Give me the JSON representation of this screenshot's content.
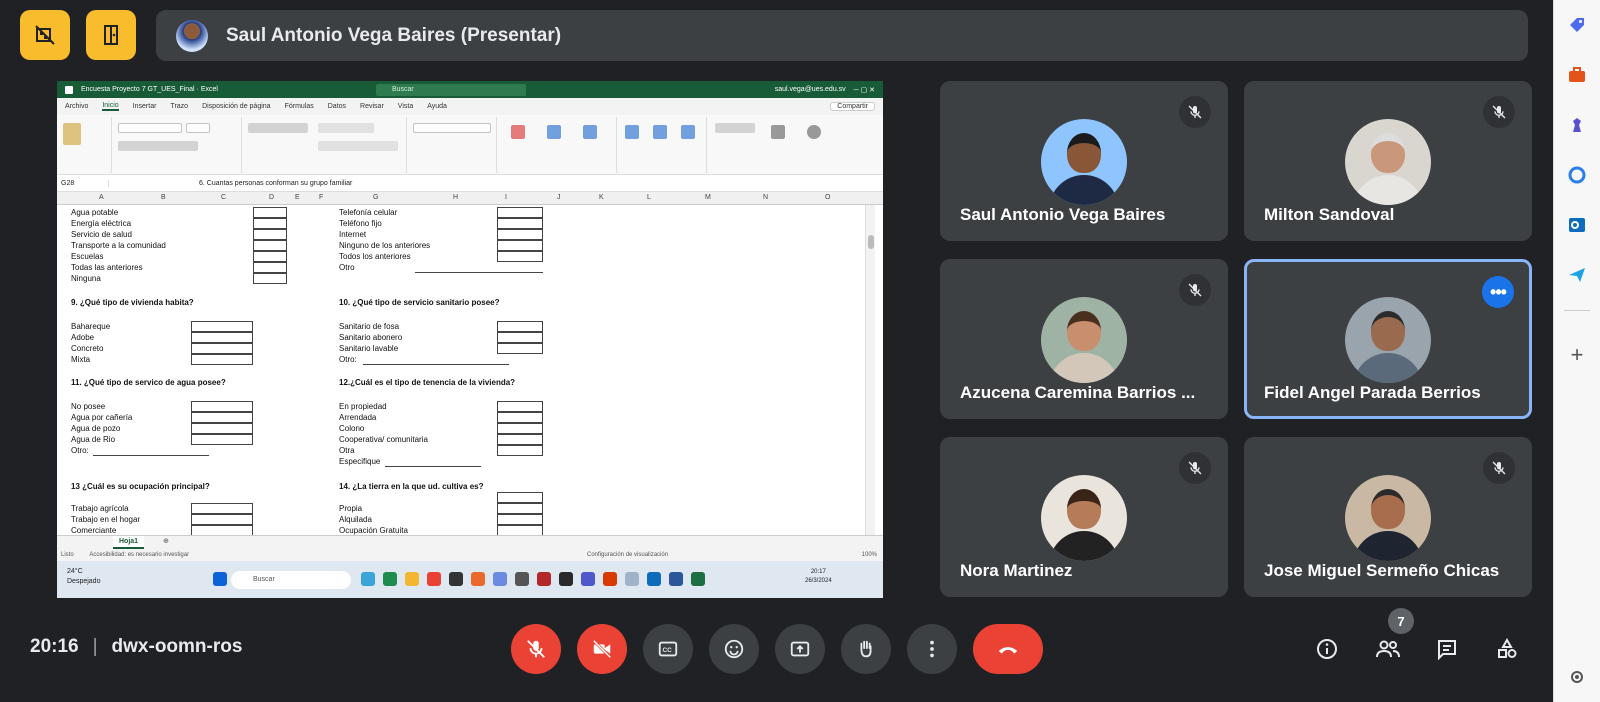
{
  "meeting": {
    "presenter_label": "Saul Antonio Vega Baires (Presentar)",
    "time": "20:16",
    "code": "dwx-oomn-ros",
    "participant_count": "7"
  },
  "participants": [
    {
      "name": "Saul Antonio Vega Baires",
      "muted": true
    },
    {
      "name": "Milton Sandoval",
      "muted": true
    },
    {
      "name": "Azucena Caremina Barrios ...",
      "muted": true
    },
    {
      "name": "Fidel Angel Parada Berrios",
      "muted": false,
      "active": true
    },
    {
      "name": "Nora Martinez",
      "muted": true
    },
    {
      "name": "Jose Miguel Sermeño Chicas",
      "muted": true
    }
  ],
  "shared_screen": {
    "title": "Encuesta Proyecto 7 GT_UES_Final · Excel",
    "search": "Buscar",
    "account": "saul.vega@ues.edu.sv",
    "menu": [
      "Archivo",
      "Inicio",
      "Insertar",
      "Trazo",
      "Disposición de página",
      "Fórmulas",
      "Datos",
      "Revisar",
      "Vista",
      "Ayuda"
    ],
    "share": "Compartir",
    "cell_ref": "G28",
    "formula": "6. Cuantas personas conforman su grupo familiar",
    "columns": [
      "A",
      "B",
      "C",
      "D",
      "E",
      "F",
      "G",
      "H",
      "I",
      "J",
      "K",
      "L",
      "M",
      "N",
      "O"
    ],
    "left_list_1": [
      "Agua potable",
      "Energía eléctrica",
      "Servicio de salud",
      "Transporte a la comunidad",
      "Escuelas",
      "Todas las anteriores",
      "Ninguna"
    ],
    "right_list_1": [
      "Telefonía celular",
      "Teléfono fijo",
      "Internet",
      "Ninguno de los anteriores",
      "Todos los anteriores",
      "Otro"
    ],
    "q9": "9. ¿Qué tipo de vivienda habita?",
    "q9_options": [
      "Bahareque",
      "Adobe",
      "Concreto",
      "Mixta"
    ],
    "q10": "10. ¿Qué tipo de servicio sanitario posee?",
    "q10_options": [
      "Sanitario de fosa",
      "Sanitario abonero",
      "Sanitario lavable",
      "Otro:"
    ],
    "q11": "11. ¿Qué tipo de servico de agua posee?",
    "q11_options": [
      "No posee",
      "Agua por cañería",
      "Agua de pozo",
      "Agua de Rio",
      "Otro:"
    ],
    "q12": "12.¿Cuál es el tipo de tenencia de la vivienda?",
    "q12_options": [
      "En propiedad",
      "Arrendada",
      "Colono",
      "Cooperativa/ comunitaria",
      "Otra",
      "Especifique"
    ],
    "q13": "13 ¿Cuál es su ocupación principal?",
    "q13_options": [
      "Trabajo agrícola",
      "Trabajo en el hogar",
      "Comerciante"
    ],
    "q14": "14. ¿La tierra en la que ud. cultiva es?",
    "q14_options": [
      "Propia",
      "Alquilada",
      "Ocupación Gratuita"
    ],
    "sheet_tab": "Hoja1",
    "status": "Listo",
    "accessibility": "Accesibilidad: es necesario investigar",
    "view_setting": "Configuración de visualización",
    "zoom": "100%",
    "weather_temp": "24°C",
    "weather_desc": "Despejado",
    "taskbar_search": "Buscar",
    "clock_time": "20:17",
    "clock_date": "26/3/2024"
  },
  "colors": {
    "meet_bg": "#202124",
    "tile_bg": "#3c4043",
    "yellow": "#f9bc2c",
    "red": "#ea4335",
    "blue": "#1a73e8",
    "excel_green": "#185c37"
  }
}
